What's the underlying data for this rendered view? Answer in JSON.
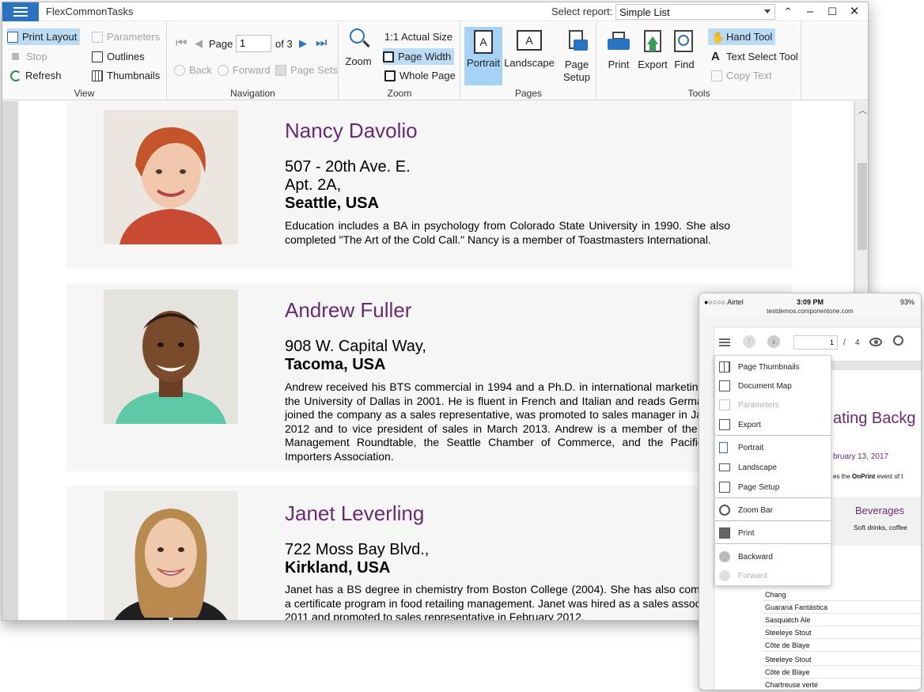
{
  "window": {
    "title": "FlexCommonTasks",
    "select_report_label": "Select report:",
    "select_report_value": "Simple List",
    "controls": {
      "minimize": "–",
      "maximize": "☐",
      "close": "✕",
      "up": "⌃"
    }
  },
  "ribbon": {
    "view": {
      "label": "View",
      "print_layout": "Print Layout",
      "stop": "Stop",
      "refresh": "Refresh",
      "parameters": "Parameters",
      "outlines": "Outlines",
      "thumbnails": "Thumbnails"
    },
    "navigation": {
      "label": "Navigation",
      "page_label": "Page",
      "page_value": "1",
      "of_label": "of 3",
      "back": "Back",
      "forward": "Forward",
      "page_sets": "Page Sets"
    },
    "zoom": {
      "label": "Zoom",
      "zoom": "Zoom",
      "actual_size": "1:1 Actual Size",
      "page_width": "Page Width",
      "whole_page": "Whole Page"
    },
    "pages": {
      "label": "Pages",
      "portrait": "Portrait",
      "landscape": "Landscape",
      "page_setup_line1": "Page",
      "page_setup_line2": "Setup"
    },
    "tools": {
      "label": "Tools",
      "print": "Print",
      "export": "Export",
      "find": "Find",
      "hand_tool": "Hand Tool",
      "text_select_tool": "Text Select Tool",
      "copy_text": "Copy Text"
    }
  },
  "employees": [
    {
      "name": "Nancy Davolio",
      "address_lines": [
        "507 - 20th Ave. E.",
        "Apt. 2A,"
      ],
      "city": "Seattle, USA",
      "notes": "Education includes a BA in psychology from Colorado State University in 1990. She also completed \"The Art of the Cold Call.\"  Nancy is a member of Toastmasters International."
    },
    {
      "name": "Andrew Fuller",
      "address_lines": [
        "908 W. Capital Way,"
      ],
      "city": "Tacoma, USA",
      "notes": "Andrew received his BTS commercial in 1994 and a Ph.D. in international marketing from the University of Dallas in 2001.  He is fluent in French and Italian and reads German.  He joined the company as a sales representative, was promoted to sales manager in January 2012 and to vice president of sales in March 2013.  Andrew is a member of the Sales Management Roundtable, the Seattle Chamber of Commerce, and the Pacific Rim Importers Association."
    },
    {
      "name": "Janet Leverling",
      "address_lines": [
        "722 Moss Bay Blvd.,"
      ],
      "city": "Kirkland, USA",
      "notes": "Janet has a BS degree in chemistry from Boston College (2004).  She has also completed a certificate program in food retailing management.  Janet was hired as a sales associate in 2011 and promoted to sales representative in February 2012."
    }
  ],
  "phone": {
    "carrier": "●○○○○ Airtel",
    "time": "3:09 PM",
    "battery": "93%",
    "url": "testdemos.componentone.com",
    "page_value": "1",
    "page_sep": "/",
    "page_total": "4",
    "menu": [
      {
        "label": "Page Thumbnails",
        "disabled": false
      },
      {
        "label": "Document Map",
        "disabled": false
      },
      {
        "label": "Parameters",
        "disabled": true
      },
      {
        "label": "Export",
        "disabled": false
      },
      {
        "label": "Portrait",
        "disabled": false
      },
      {
        "label": "Landscape",
        "disabled": false
      },
      {
        "label": "Page Setup",
        "disabled": false
      },
      {
        "label": "Zoom Bar",
        "disabled": false
      },
      {
        "label": "Print",
        "disabled": false
      },
      {
        "label": "Backward",
        "disabled": false
      },
      {
        "label": "Forward",
        "disabled": true
      }
    ],
    "doc_heading": "ating Backg",
    "doc_date": "bruary 13, 2017",
    "doc_line_pre": "es the ",
    "doc_line_bold": "OnPrint",
    "doc_line_post": " event of t",
    "doc_category": "Beverages",
    "doc_category_desc": "Soft drinks, coffee",
    "products": [
      "Chang",
      "Guaraná Fantástica",
      "Sasquatch Ale",
      "Steeleye Stout",
      "Côte de Blaye",
      "Steeleye Stout",
      "Côte de Blaye",
      "Chartreuse verte"
    ]
  }
}
